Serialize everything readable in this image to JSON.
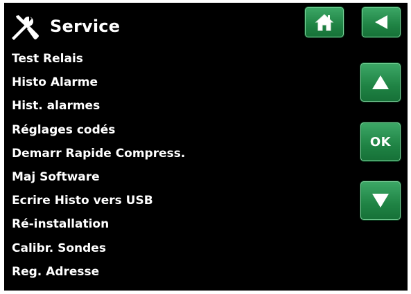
{
  "header": {
    "title": "Service",
    "icon": "tools-icon"
  },
  "nav": {
    "home_icon": "home-icon",
    "back_icon": "back-arrow-icon",
    "up_icon": "up-arrow-icon",
    "ok_label": "OK",
    "down_icon": "down-arrow-icon"
  },
  "menu": {
    "items": [
      {
        "label": "Test Relais"
      },
      {
        "label": "Histo Alarme"
      },
      {
        "label": "Hist. alarmes"
      },
      {
        "label": "Réglages codés"
      },
      {
        "label": "Demarr Rapide Compress."
      },
      {
        "label": "Maj Software"
      },
      {
        "label": "Ecrire Histo vers USB"
      },
      {
        "label": "Ré-installation"
      },
      {
        "label": "Calibr. Sondes"
      },
      {
        "label": "Reg. Adresse"
      }
    ]
  },
  "colors": {
    "background": "#000000",
    "text": "#ffffff",
    "button_green": "#1f8344",
    "button_highlight": "#7ad39a"
  }
}
